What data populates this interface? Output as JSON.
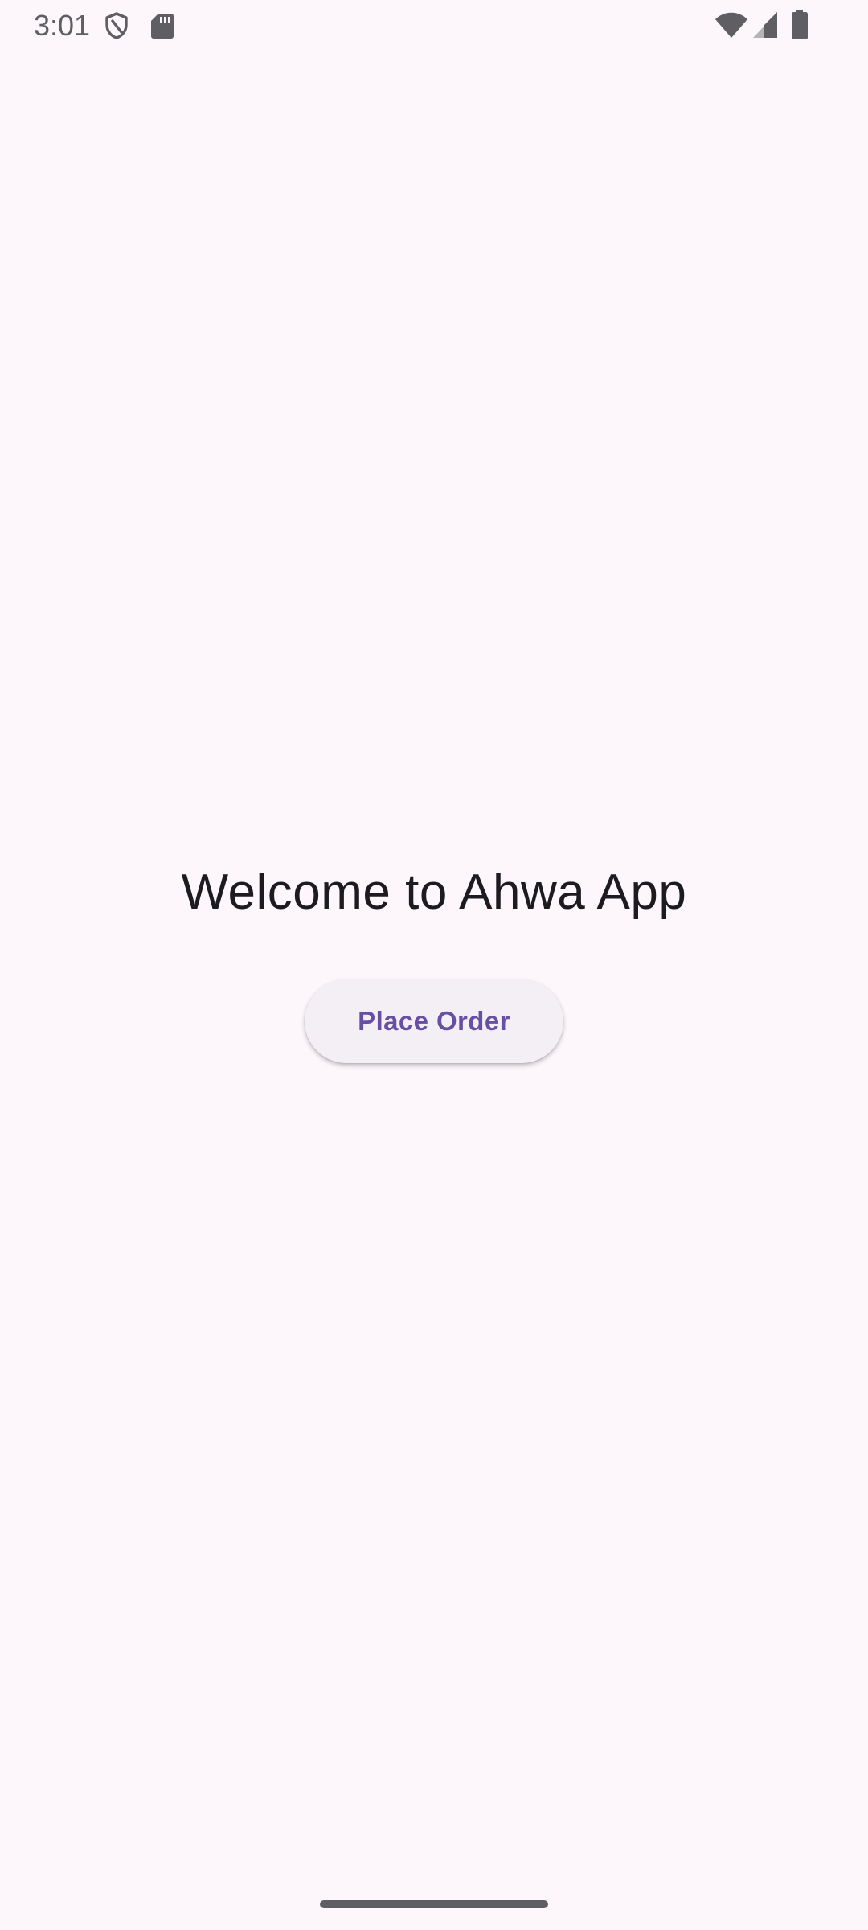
{
  "status_bar": {
    "time": "3:01",
    "icons_left": [
      "shield-icon",
      "sd-card-icon"
    ],
    "icons_right": [
      "wifi-icon",
      "signal-icon",
      "battery-icon"
    ],
    "text_color": "#5f5f63",
    "icon_color": "#5f5f63"
  },
  "main": {
    "title": "Welcome to Ahwa App",
    "place_order_label": "Place Order"
  },
  "colors": {
    "background": "#fdf7fc",
    "title_text": "#1c1b1f",
    "button_background": "#f4eff4",
    "button_text": "#6750a4",
    "home_indicator": "#5f5f63"
  }
}
